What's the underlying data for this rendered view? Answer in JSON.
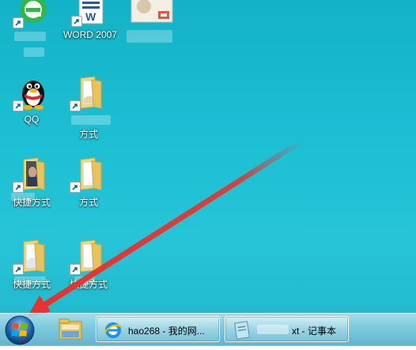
{
  "desktop": {
    "icons": [
      {
        "label": ""
      },
      {
        "label": "WORD 2007"
      },
      {
        "label": ""
      },
      {
        "label": "QQ"
      },
      {
        "label": "方式"
      },
      {
        "label": "快捷方式"
      },
      {
        "label": "方式"
      },
      {
        "label": "快捷方式"
      },
      {
        "label": "快捷方式"
      }
    ]
  },
  "taskbar": {
    "buttons": [
      {
        "label": "hao268 - 我的网..."
      },
      {
        "label": "xt - 记事本"
      }
    ]
  },
  "colors": {
    "desktop": "#1cbfd3",
    "arrow": "#e8322f",
    "taskbar": "#8fc9dc"
  }
}
